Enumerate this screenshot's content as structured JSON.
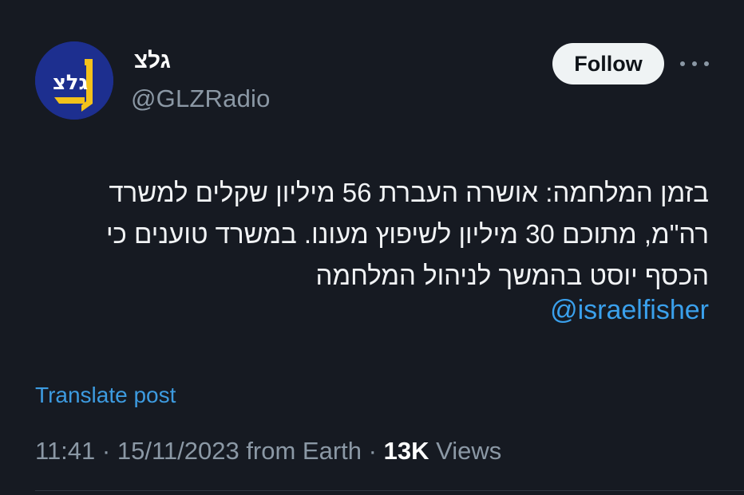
{
  "author": {
    "display_name": "גלצ",
    "handle": "@GLZRadio",
    "avatar_logo_text": "גלצ",
    "avatar_bg": "#1d2f8f",
    "avatar_accent": "#f3c21b"
  },
  "actions": {
    "follow_label": "Follow",
    "more_icon": "more-horizontal-icon"
  },
  "tweet": {
    "lines": [
      "בזמן המלחמה: אושרה העברת 56 מיליון שקלים למשרד",
      "רה\"מ, מתוכם 30 מיליון לשיפוץ מעונו. במשרד טוענים כי",
      "הכסף יוסט בהמשך לניהול המלחמה"
    ],
    "mention": "@israelfisher"
  },
  "translate_label": "Translate post",
  "meta": {
    "time": "11:41",
    "sep1": " · ",
    "date": "15/11/2023",
    "source": " from Earth",
    "sep2": " · ",
    "views_count": "13K",
    "views_label": " Views"
  },
  "colors": {
    "background": "#161a22",
    "link": "#3d9be0",
    "muted": "#8b98a5"
  }
}
